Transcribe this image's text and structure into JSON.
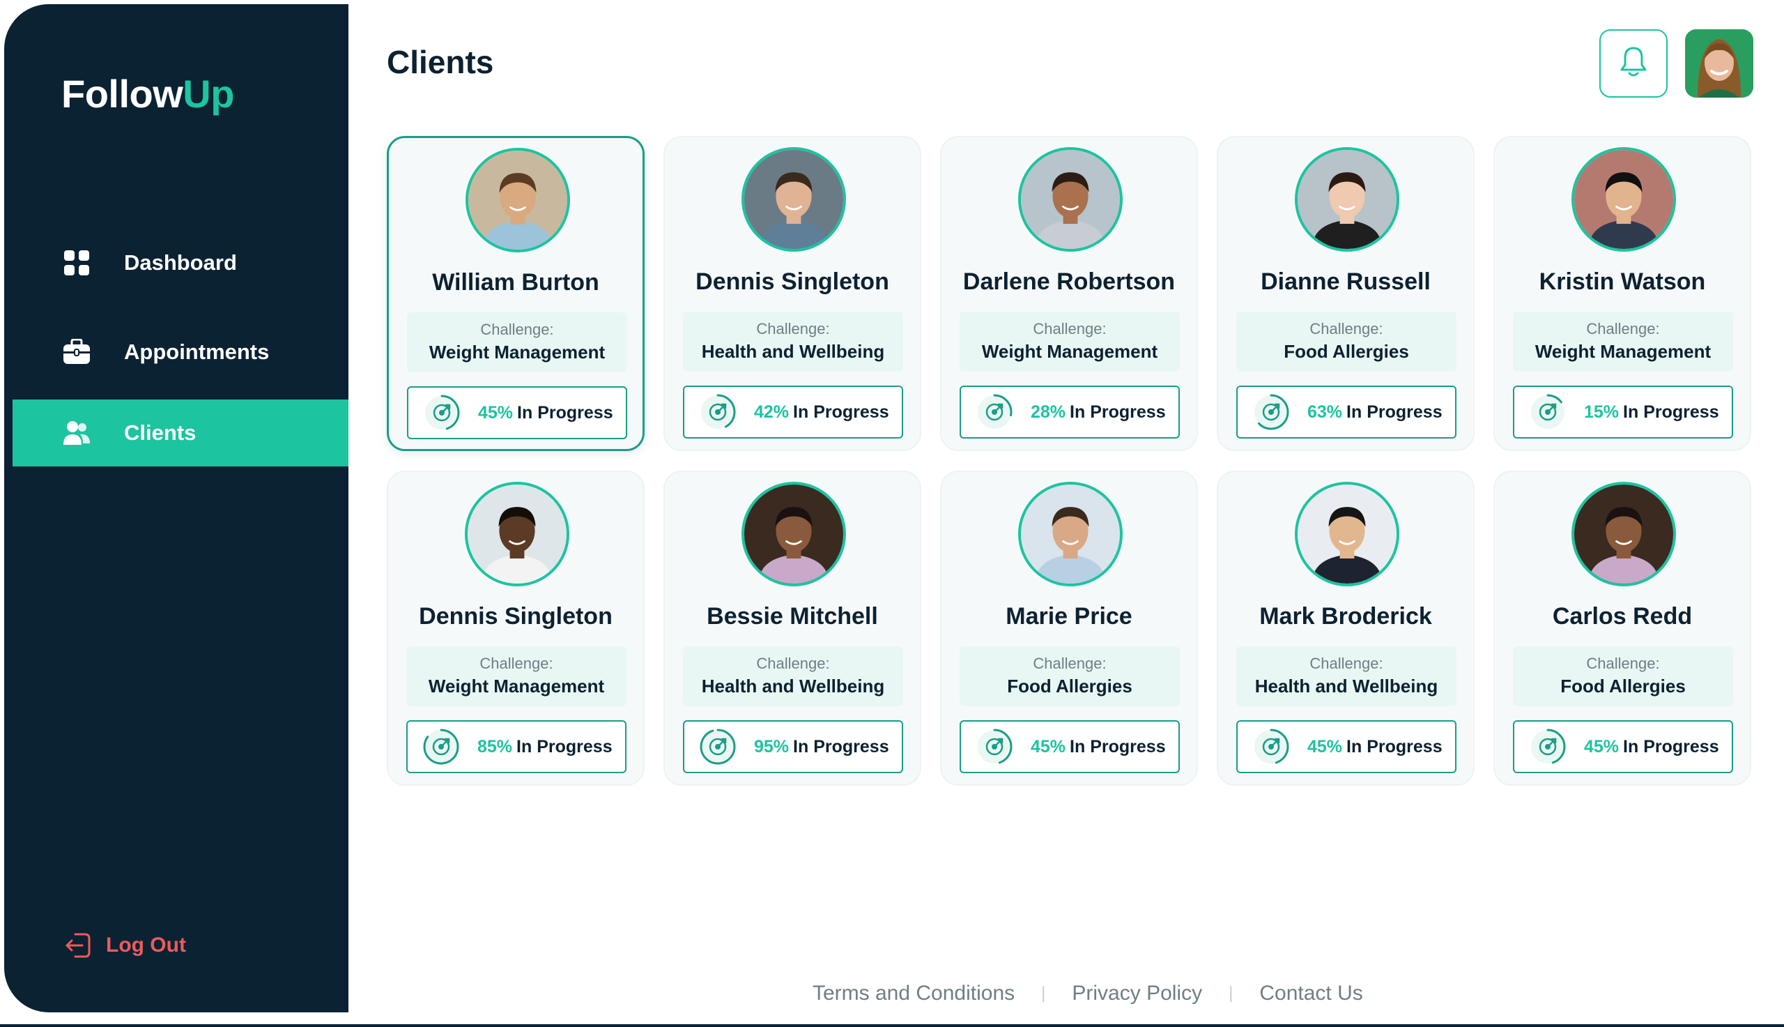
{
  "app": {
    "logo_part1": "Follow",
    "logo_part2": "Up"
  },
  "colors": {
    "sidebar_bg": "#0b2233",
    "accent": "#1cc4a0",
    "logout": "#ef5a5a"
  },
  "sidebar": {
    "items": [
      {
        "label": "Dashboard",
        "icon": "grid-icon",
        "active": false
      },
      {
        "label": "Appointments",
        "icon": "briefcase-icon",
        "active": false
      },
      {
        "label": "Clients",
        "icon": "users-icon",
        "active": true
      }
    ],
    "logout_label": "Log Out"
  },
  "header": {
    "title": "Clients"
  },
  "clients": [
    {
      "name": "William Burton",
      "challenge_label": "Challenge:",
      "challenge": "Weight Management",
      "progress": "45%",
      "progress_value": 45,
      "status": "In Progress",
      "selected": true
    },
    {
      "name": "Dennis Singleton",
      "challenge_label": "Challenge:",
      "challenge": "Health and Wellbeing",
      "progress": "42%",
      "progress_value": 42,
      "status": "In Progress",
      "selected": false
    },
    {
      "name": "Darlene Robertson",
      "challenge_label": "Challenge:",
      "challenge": "Weight Management",
      "progress": "28%",
      "progress_value": 28,
      "status": "In Progress",
      "selected": false
    },
    {
      "name": "Dianne Russell",
      "challenge_label": "Challenge:",
      "challenge": "Food Allergies",
      "progress": "63%",
      "progress_value": 63,
      "status": "In Progress",
      "selected": false
    },
    {
      "name": "Kristin Watson",
      "challenge_label": "Challenge:",
      "challenge": "Weight Management",
      "progress": "15%",
      "progress_value": 15,
      "status": "In Progress",
      "selected": false
    },
    {
      "name": "Dennis Singleton",
      "challenge_label": "Challenge:",
      "challenge": "Weight Management",
      "progress": "85%",
      "progress_value": 85,
      "status": "In Progress",
      "selected": false
    },
    {
      "name": "Bessie Mitchell",
      "challenge_label": "Challenge:",
      "challenge": "Health and Wellbeing",
      "progress": "95%",
      "progress_value": 95,
      "status": "In Progress",
      "selected": false
    },
    {
      "name": "Marie Price",
      "challenge_label": "Challenge:",
      "challenge": "Food Allergies",
      "progress": "45%",
      "progress_value": 45,
      "status": "In Progress",
      "selected": false
    },
    {
      "name": "Mark Broderick",
      "challenge_label": "Challenge:",
      "challenge": "Health and Wellbeing",
      "progress": "45%",
      "progress_value": 45,
      "status": "In Progress",
      "selected": false
    },
    {
      "name": "Carlos Redd",
      "challenge_label": "Challenge:",
      "challenge": "Food Allergies",
      "progress": "45%",
      "progress_value": 45,
      "status": "In Progress",
      "selected": false
    }
  ],
  "footer": {
    "links": [
      "Terms and Conditions",
      "Privacy Policy",
      "Contact Us"
    ]
  }
}
